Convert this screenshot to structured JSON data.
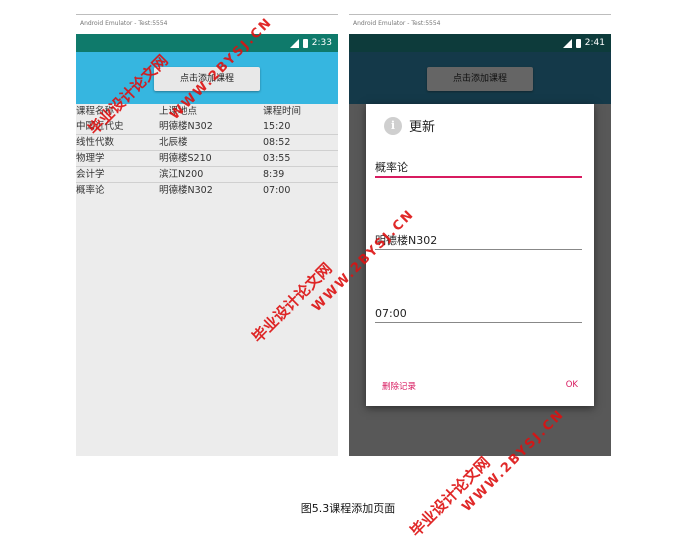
{
  "left_screen": {
    "emulator_title": "Android Emulator - Test:5554",
    "time": "2:33",
    "status_bar_color": "#0f7a6b",
    "app_bar_color": "#36b6e0",
    "add_button_label": "点击添加课程",
    "table": {
      "headers": [
        "课程名称",
        "上课地点",
        "课程时间"
      ],
      "rows": [
        [
          "中国近代史",
          "明德楼N302",
          "15:20"
        ],
        [
          "线性代数",
          "北辰楼",
          "08:52"
        ],
        [
          "物理学",
          "明德楼S210",
          "03:55"
        ],
        [
          "会计学",
          "滨江N200",
          "8:39"
        ],
        [
          "概率论",
          "明德楼N302",
          "07:00"
        ]
      ]
    }
  },
  "right_screen": {
    "emulator_title": "Android Emulator - Test:5554",
    "time": "2:41",
    "add_button_label": "点击添加课程",
    "dialog": {
      "title": "更新",
      "icon": "info-icon",
      "course_name": "概率论",
      "location": "明德楼N302",
      "time": "07:00",
      "delete_label": "删除记录",
      "ok_label": "OK",
      "accent_color": "#d81b60"
    }
  },
  "caption": "图5.3课程添加页面",
  "watermark": {
    "cn": "毕业设计论文网",
    "en": "WWW.2BYSJ.CN",
    "color": "#d11111"
  }
}
